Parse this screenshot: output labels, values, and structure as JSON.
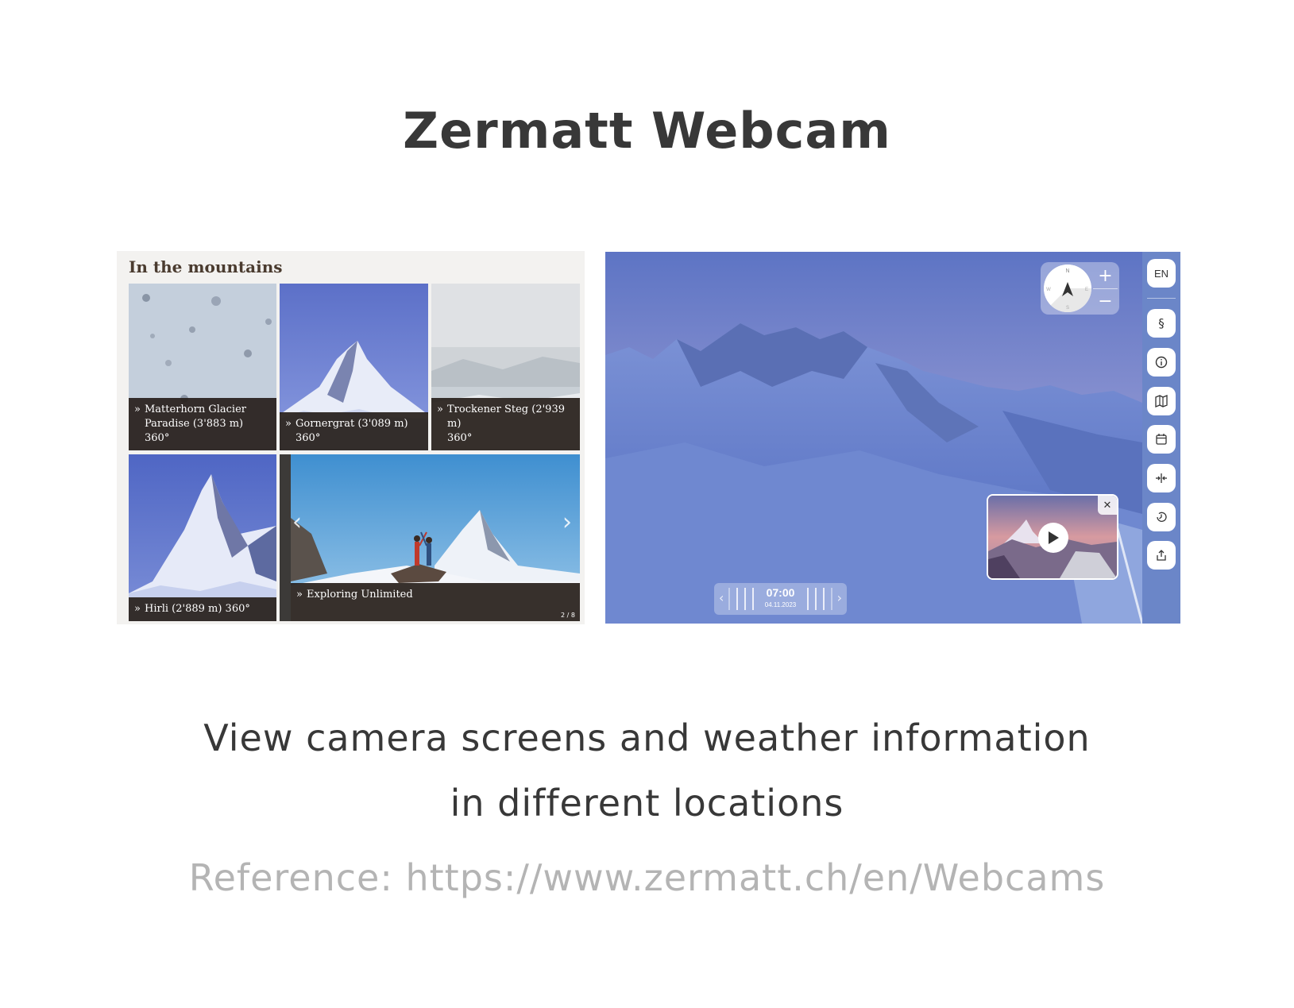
{
  "page": {
    "title": "Zermatt Webcam",
    "subtitle_line1": "View camera screens and weather information",
    "subtitle_line2": "in different locations",
    "reference": "Reference: https://www.zermatt.ch/en/Webcams"
  },
  "left_panel": {
    "heading": "In the mountains",
    "raquo": "»",
    "tiles": [
      {
        "label_line1": "Matterhorn Glacier",
        "label_line2": "Paradise (3'883 m) 360°"
      },
      {
        "label_line1": "Gornergrat (3'089 m) 360°",
        "label_line2": ""
      },
      {
        "label_line1": "Trockener Steg (2'939 m)",
        "label_line2": "360°"
      },
      {
        "label_line1": "Hirli (2'889 m) 360°",
        "label_line2": ""
      },
      {
        "label_line1": "Exploring Unlimited",
        "label_line2": ""
      }
    ],
    "pager": "2 / 8",
    "prev_arrow": "‹",
    "next_arrow": "›"
  },
  "viewer": {
    "language": "EN",
    "sidebar_icons": [
      "paragraph-icon",
      "info-icon",
      "map-icon",
      "calendar-icon",
      "compare-icon",
      "history-icon",
      "share-icon"
    ],
    "paragraph_symbol": "§",
    "compass": {
      "n": "N",
      "e": "E",
      "s": "S",
      "w": "W"
    },
    "zoom_in": "+",
    "zoom_out": "−",
    "time": "07:00",
    "date": "04.11.2023",
    "close": "✕",
    "colors": {
      "sky": "#5b78c6",
      "sidebar": "#6b86c8",
      "snow": "#aebde6"
    }
  }
}
